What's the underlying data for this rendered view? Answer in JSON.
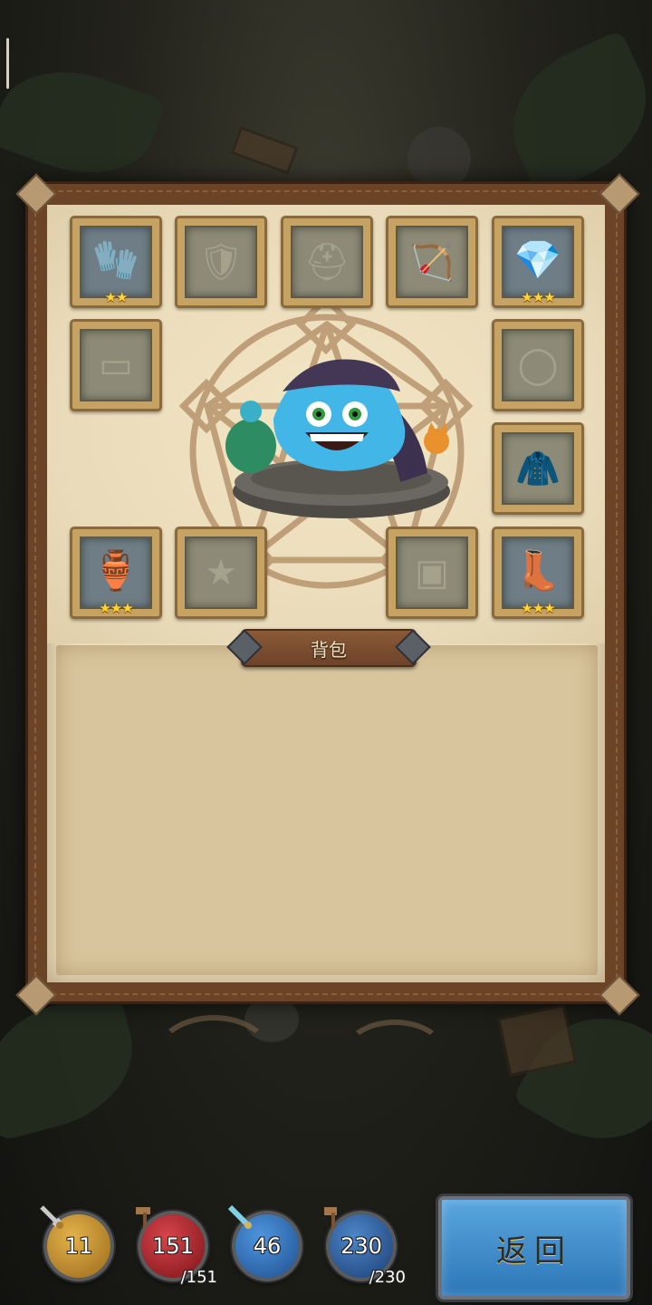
{
  "equipment_slots": [
    {
      "name": "gauntlet-slot",
      "state": "equipped",
      "icon": "gauntlet-icon",
      "stars": "★★"
    },
    {
      "name": "armor-slot",
      "state": "empty",
      "icon": "armor-icon",
      "stars": ""
    },
    {
      "name": "helmet-slot",
      "state": "empty",
      "icon": "helmet-icon",
      "stars": ""
    },
    {
      "name": "crossbow-slot",
      "state": "empty",
      "icon": "crossbow-icon",
      "stars": ""
    },
    {
      "name": "necklace-slot",
      "state": "equipped",
      "icon": "sapphire-necklace-icon",
      "stars": "★★★"
    },
    {
      "name": "belt-slot",
      "state": "empty",
      "icon": "belt-icon",
      "stars": ""
    },
    {
      "name": "ring-slot",
      "state": "empty",
      "icon": "ring-icon",
      "stars": ""
    },
    {
      "name": "cloak-slot",
      "state": "empty",
      "icon": "cloak-icon",
      "stars": ""
    },
    {
      "name": "pet-slot",
      "state": "equipped",
      "icon": "gourd-icon",
      "stars": "★★★"
    },
    {
      "name": "badge-slot",
      "state": "empty",
      "icon": "badge-icon",
      "stars": ""
    },
    {
      "name": "chest-slot",
      "state": "empty",
      "icon": "treasure-chest-icon",
      "stars": ""
    },
    {
      "name": "boots-slot",
      "state": "equipped",
      "icon": "winged-boots-icon",
      "stars": "★★★"
    }
  ],
  "bag": {
    "label": "背包"
  },
  "stats": [
    {
      "name": "attack",
      "value": "11",
      "max": "",
      "color": "#c7922e",
      "icon": "sword-icon"
    },
    {
      "name": "hp",
      "value": "151",
      "max": "/151",
      "color": "#b8272c",
      "icon": "hammer-icon"
    },
    {
      "name": "defense",
      "value": "46",
      "max": "",
      "color": "#2e6bb5",
      "icon": "blue-sword-icon"
    },
    {
      "name": "mana",
      "value": "230",
      "max": "/230",
      "color": "#2f5f9e",
      "icon": "mace-icon"
    }
  ],
  "return_button": {
    "label": "返回"
  }
}
